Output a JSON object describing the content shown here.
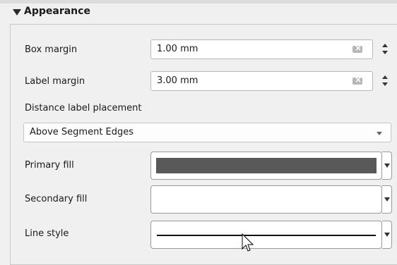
{
  "section": {
    "title": "Appearance"
  },
  "fields": {
    "box_margin": {
      "label": "Box margin",
      "value": "1.00 mm"
    },
    "label_margin": {
      "label": "Label margin",
      "value": "3.00 mm"
    },
    "distance_label_placement": {
      "label": "Distance label placement",
      "value": "Above Segment Edges"
    },
    "primary_fill": {
      "label": "Primary fill",
      "color": "#595959"
    },
    "secondary_fill": {
      "label": "Secondary fill",
      "color": "#ffffff"
    },
    "line_style": {
      "label": "Line style"
    }
  },
  "icons": {
    "section_toggle": "triangle-down-icon",
    "clear": "clear-icon",
    "stepper": "stepper-icon",
    "dropdown": "chevron-down-icon",
    "cursor": "mouse-pointer-icon"
  }
}
